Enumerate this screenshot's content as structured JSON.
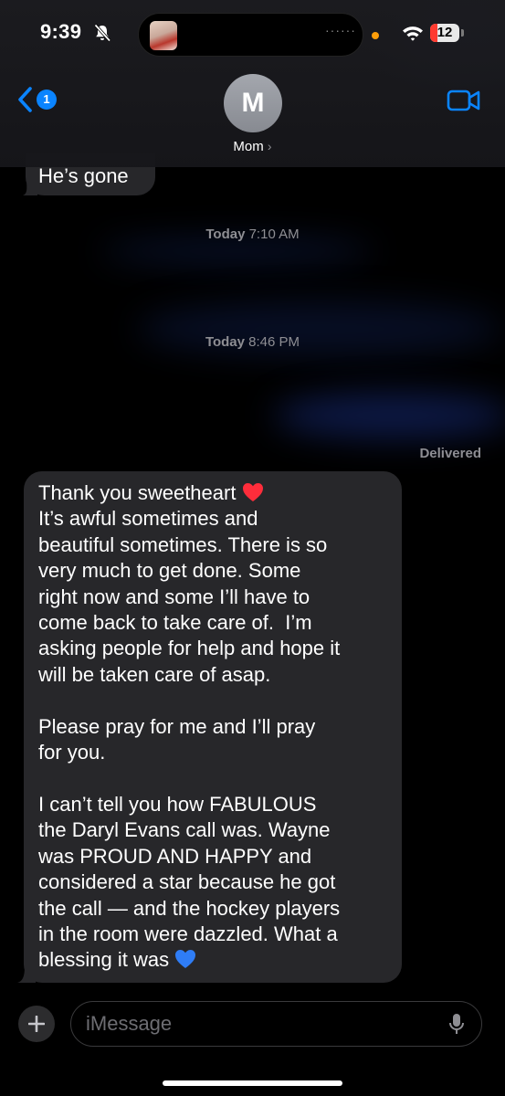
{
  "status_bar": {
    "time": "9:39",
    "battery_level": "12",
    "battery_color": "#ff3b30",
    "icons": [
      "bell-slash-icon",
      "wifi-icon",
      "battery-icon"
    ]
  },
  "header": {
    "back_badge": "1",
    "avatar_initial": "M",
    "contact_name": "Mom",
    "contact_chevron": "›",
    "accent_color": "#0a84ff"
  },
  "messages": [
    {
      "from": "Mom",
      "text": "He’s gone"
    },
    {
      "from": "Mom",
      "lines": [
        "Thank you sweetheart",
        "It’s awful sometimes and\nbeautiful sometimes. There is so\nvery much to get done. Some\nright now and some I’ll have to\ncome back to take care of.  I’m\nasking people for help and hope it\nwill be taken care of asap.\n\nPlease pray for me and I’ll pray\nfor you.\n\nI can’t tell you how FABULOUS\nthe Daryl Evans call was. Wayne\nwas PROUD AND HAPPY and\nconsidered a star because he got\nthe call — and the hockey players\nin the room were dazzled. What a\nblessing it was"
      ],
      "emojis": [
        "red-heart",
        "blue-heart"
      ]
    }
  ],
  "timestamps": [
    {
      "day": "Today",
      "time": "7:10 AM"
    },
    {
      "day": "Today",
      "time": "8:46 PM"
    }
  ],
  "delivery_status": "Delivered",
  "composer": {
    "placeholder": "iMessage"
  }
}
